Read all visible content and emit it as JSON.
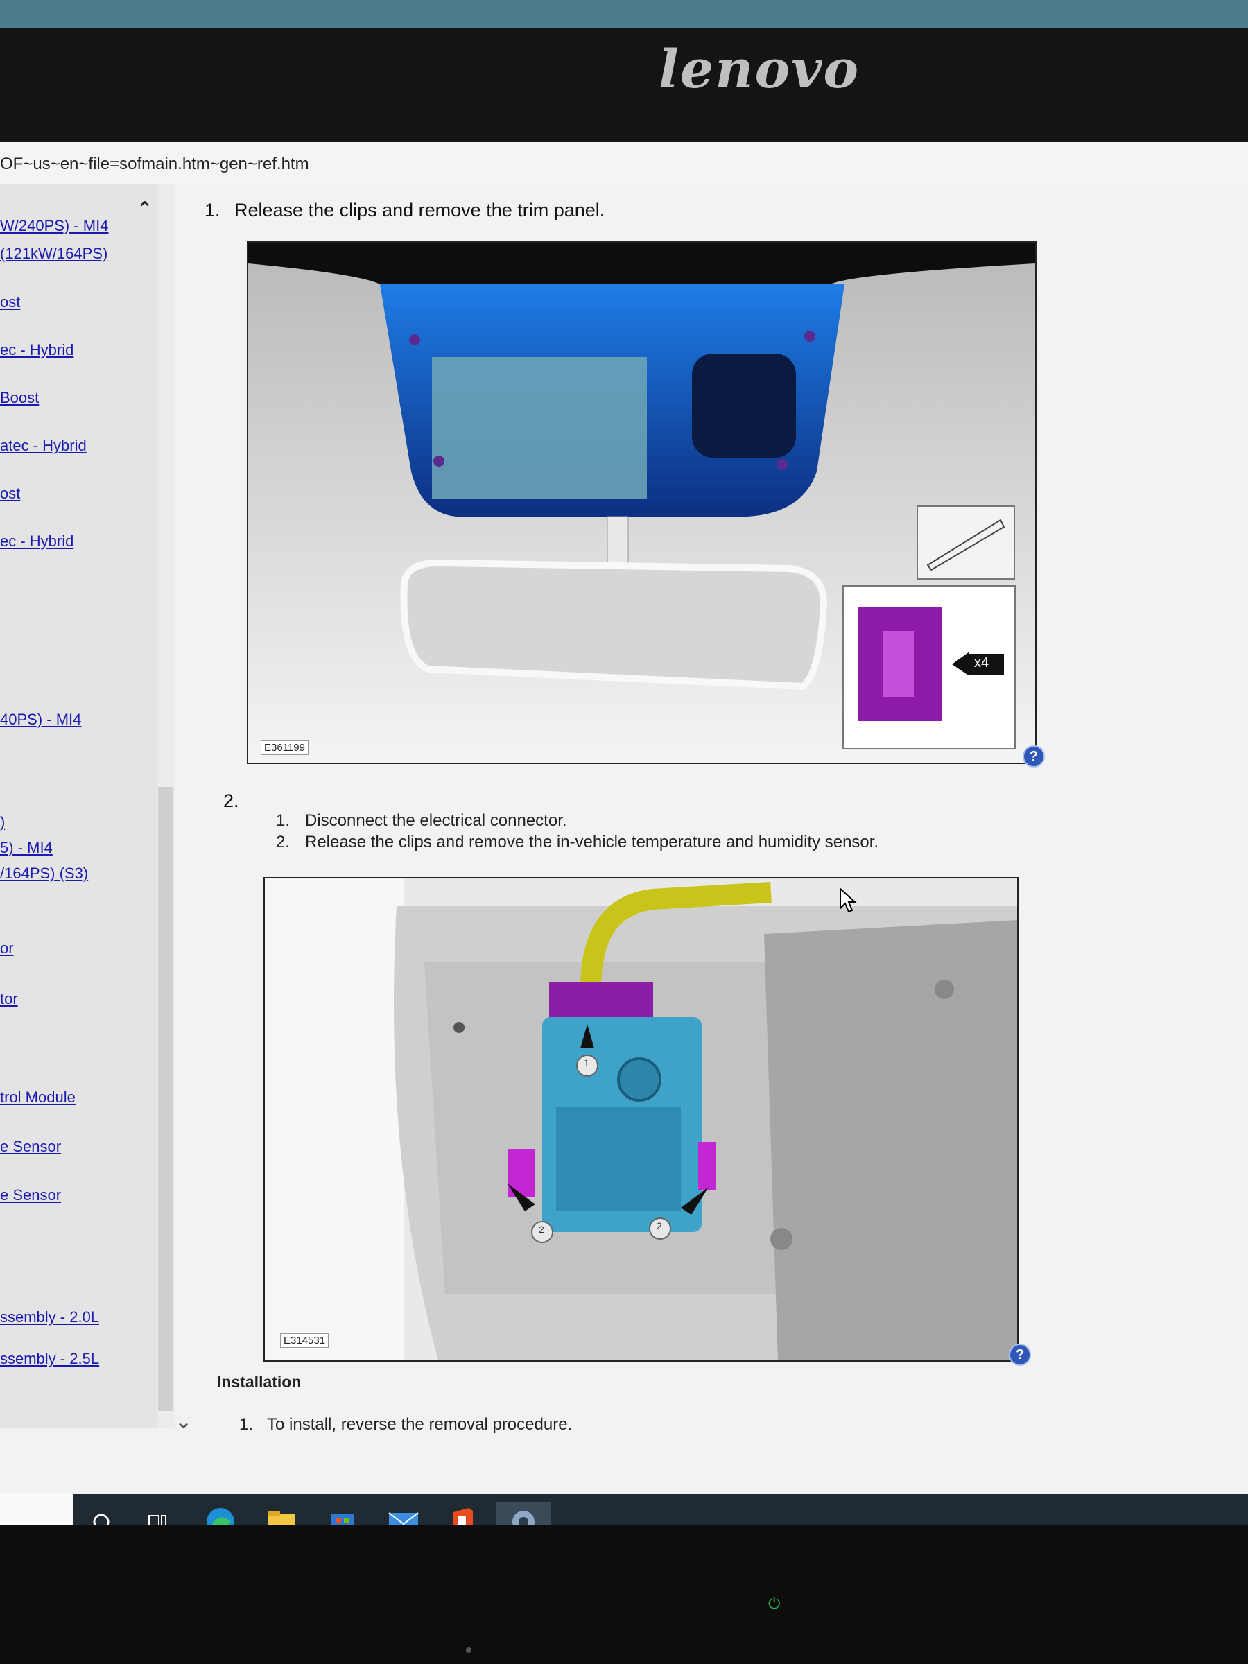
{
  "monitor": {
    "brand": "lenovo"
  },
  "browser": {
    "url_fragment": "OF~us~en~file=sofmain.htm~gen~ref.htm"
  },
  "sidebar": {
    "links": [
      "W/240PS) - MI4",
      "(121kW/164PS)",
      "ost",
      "ec - Hybrid",
      "Boost",
      "atec - Hybrid",
      "ost",
      "ec - Hybrid",
      "40PS) - MI4",
      ")",
      "5) - MI4",
      "/164PS) (S3)",
      "or",
      "tor",
      "trol Module",
      "e Sensor",
      "e Sensor",
      "ssembly - 2.0L",
      "ssembly - 2.5L"
    ]
  },
  "removal": {
    "step1": {
      "num": "1.",
      "text": "Release the clips and remove the trim panel."
    },
    "figure1": {
      "id": "E361199",
      "clip_count": "x4"
    },
    "step2": {
      "num": "2.",
      "substeps": [
        {
          "num": "1.",
          "text": "Disconnect the electrical connector."
        },
        {
          "num": "2.",
          "text": "Release the clips and remove the in-vehicle temperature and humidity sensor."
        }
      ]
    },
    "figure2": {
      "id": "E314531",
      "callouts": [
        "1",
        "2",
        "2"
      ]
    }
  },
  "installation": {
    "title": "Installation",
    "step1": {
      "num": "1.",
      "text": "To install, reverse the removal procedure."
    }
  },
  "help": {
    "symbol": "?"
  }
}
